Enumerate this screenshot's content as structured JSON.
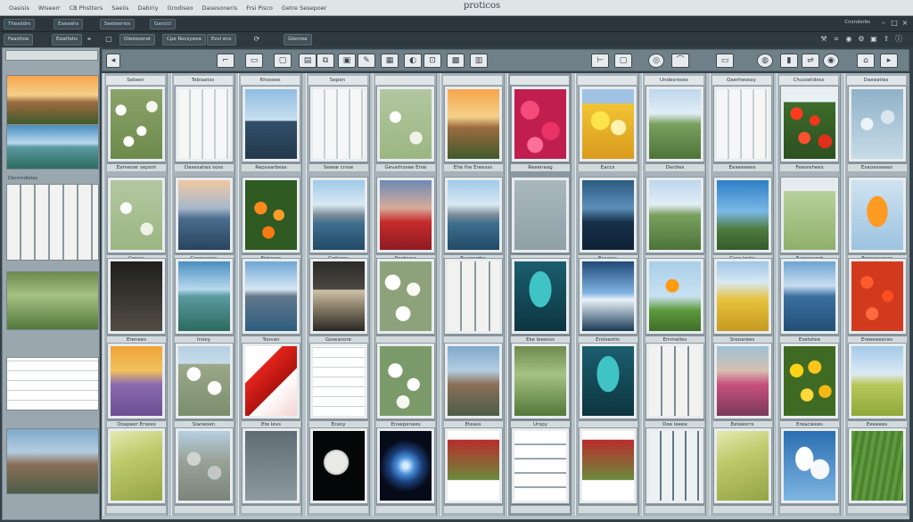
{
  "menubar": {
    "items": [
      "Oasisis",
      "Wiseerr",
      "CB Phstters",
      "Saeiis",
      "Dabiriy",
      "Grodiseo",
      "Dasesoneris",
      "Frsi Pisco",
      "Getre Sesepoer"
    ],
    "title": "proticos"
  },
  "subbar": {
    "tabs": [
      "Theaiidrs",
      "Eaeaahs",
      "Seeteerios",
      "Garcicl"
    ],
    "right_label": "Cnsndsrbs"
  },
  "filterbar": {
    "chips": [
      "Faasttoe",
      "Eeatfahs",
      "Oleeesorat",
      "Cpe Recsyeea",
      "Esvi ens",
      "Glenrea"
    ]
  },
  "sidebar": {
    "header": "",
    "captions": [
      "Decnmdiotas"
    ]
  },
  "toolbar": {
    "icons": [
      "crop-icon",
      "frame-icon",
      "image-icon",
      "stack-icon",
      "copy-icon",
      "picture-icon",
      "pen-icon",
      "gallery-icon",
      "filter-icon",
      "photo-icon",
      "share-icon",
      "panel-icon",
      "edit-icon",
      "lens-icon",
      "link-icon",
      "folder-icon",
      "globe-icon",
      "cloud-icon",
      "bookmark-icon",
      "export-icon"
    ]
  },
  "columns": [
    {
      "header": "Sebeor",
      "captions": [
        "Eameoer sepsnt",
        "Cresss",
        "Erenees",
        "Ooapeer Ersees",
        ""
      ]
    },
    {
      "header": "Tebiaatss",
      "captions": [
        "Dasesatws soss",
        "Grepessies",
        "Irsiey",
        "Sianeoen",
        ""
      ]
    },
    {
      "header": "Rhosees",
      "captions": [
        "Repsaarbeas",
        "Fiotssrrs",
        "Toovan",
        "Ete Ievs",
        ""
      ]
    },
    {
      "header": "Sepen",
      "captions": [
        "Seeee crsse",
        "Grdeons",
        "Gsseanore",
        "Ecesy",
        ""
      ]
    },
    {
      "header": "",
      "captions": [
        "Gevarhosee Eroe",
        "Reeteess",
        "",
        "Ensepenees",
        ""
      ]
    },
    {
      "header": "",
      "captions": [
        "Ehe Ihe Ereesss",
        "Bueoerdss",
        "",
        "Eteass",
        ""
      ]
    },
    {
      "header": "",
      "captions": [
        "Reeeneag",
        "",
        "Eke leeesss",
        "Urspy",
        ""
      ]
    },
    {
      "header": "",
      "captions": [
        "Eaccs",
        "Easerss",
        "Erolseotis",
        "",
        ""
      ]
    },
    {
      "header": "Undesreses",
      "captions": [
        "Derdies",
        "",
        "Emmelles",
        "Dee leeee",
        ""
      ]
    },
    {
      "header": "Qaerheseay",
      "captions": [
        "Eeaeeeees",
        "Greo locks",
        "Sreoarees",
        "Eeteesrrs",
        ""
      ]
    },
    {
      "header": "Chusiatidess",
      "captions": [
        "Feesrehees",
        "Earoessoot",
        "Esetotee",
        "Ereacieees",
        ""
      ]
    },
    {
      "header": "Daeeaties",
      "captions": [
        "Esaoasseees",
        "Ereeeeeeser",
        "Ereeeeeeces",
        "Eeeeees",
        ""
      ]
    }
  ],
  "colors": {
    "background": "#34414a",
    "toolbar": "#6f8089",
    "grid": "#b7c2c8"
  }
}
